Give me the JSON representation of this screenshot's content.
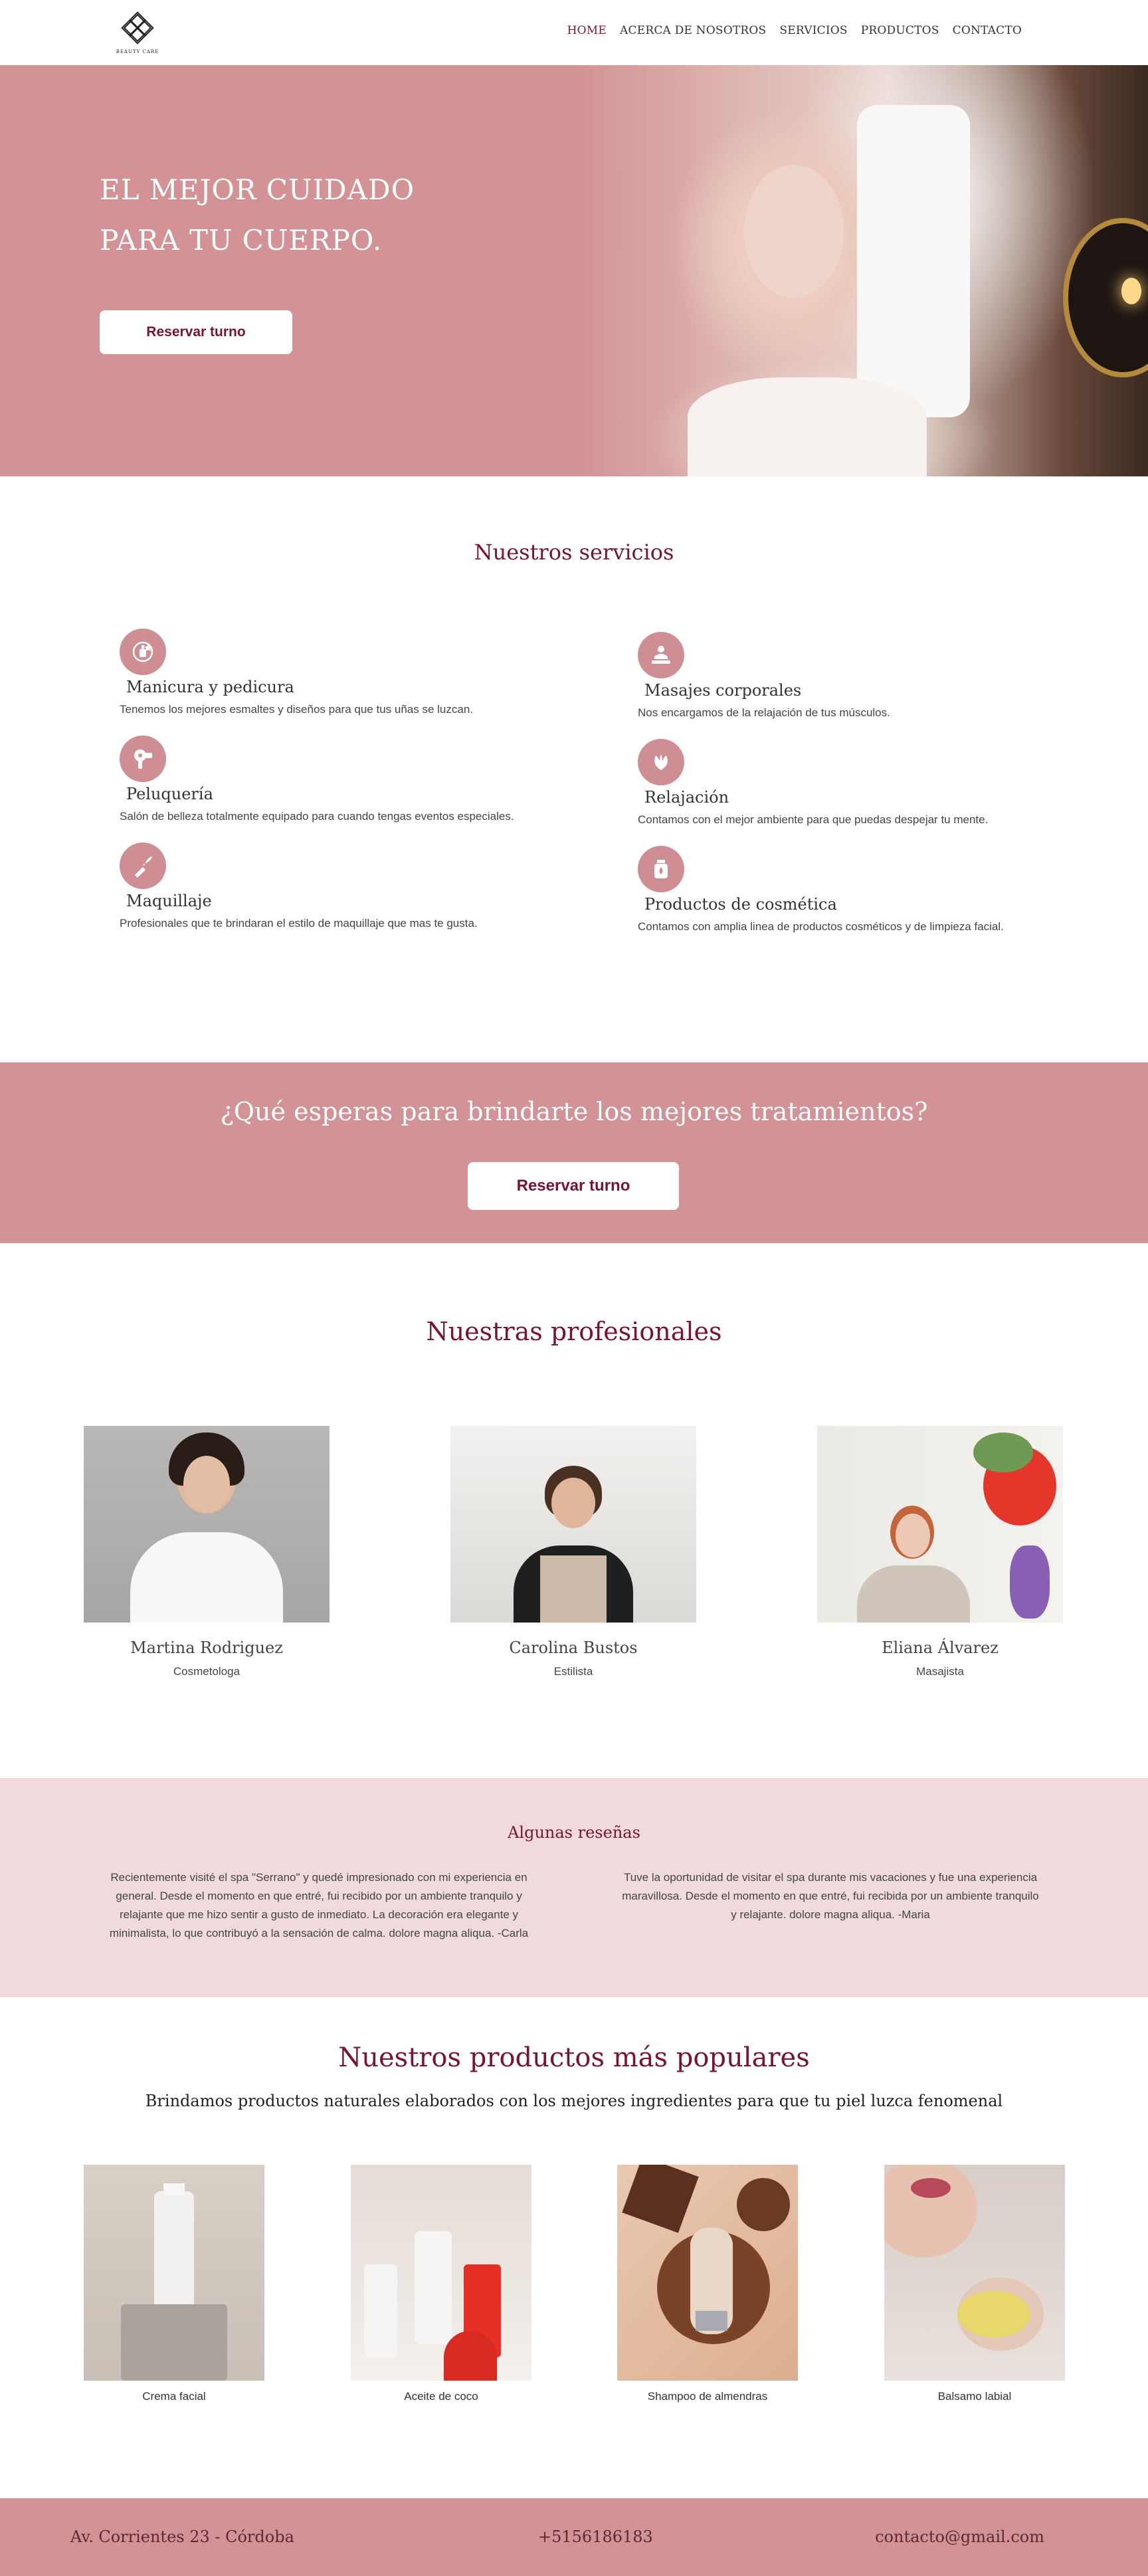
{
  "nav": {
    "logo_text": "BEAUTY CARE",
    "links": [
      {
        "label": "HOME",
        "active": true
      },
      {
        "label": "ACERCA DE NOSOTROS",
        "active": false
      },
      {
        "label": "SERVICIOS",
        "active": false
      },
      {
        "label": "PRODUCTOS",
        "active": false
      },
      {
        "label": "CONTACTO",
        "active": false
      }
    ]
  },
  "hero": {
    "title_line1": "EL MEJOR CUIDADO",
    "title_line2": "PARA TU CUERPO.",
    "button_label": "Reservar turno"
  },
  "services": {
    "title": "Nuestros servicios",
    "items": [
      {
        "name": "Manicura y pedicura",
        "desc": "Tenemos los mejores esmaltes y diseños para que tus uñas se luzcan.",
        "icon": "nail-polish-icon"
      },
      {
        "name": "Masajes corporales",
        "desc": "Nos encargamos de la relajación de tus músculos.",
        "icon": "massage-icon"
      },
      {
        "name": "Peluquería",
        "desc": "Salón de belleza totalmente equipado para cuando tengas eventos especiales.",
        "icon": "hair-dryer-icon"
      },
      {
        "name": "Relajación",
        "desc": "Contamos con el mejor ambiente para que puedas despejar tu mente.",
        "icon": "leaf-icon"
      },
      {
        "name": "Maquillaje",
        "desc": "Profesionales que te brindaran el estilo de maquillaje que mas te gusta.",
        "icon": "makeup-brush-icon"
      },
      {
        "name": "Productos de cosmética",
        "desc": "Contamos con amplia linea de productos cosméticos y de limpieza facial.",
        "icon": "cosmetic-bottle-icon"
      }
    ]
  },
  "cta": {
    "title": "¿Qué esperas para brindarte los mejores tratamientos?",
    "button_label": "Reservar turno"
  },
  "team": {
    "title": "Nuestras profesionales",
    "members": [
      {
        "name": "Martina Rodriguez",
        "role": "Cosmetologa"
      },
      {
        "name": "Carolina Bustos",
        "role": "Estilista"
      },
      {
        "name": "Eliana Álvarez",
        "role": "Masajista"
      }
    ]
  },
  "reviews": {
    "title": "Algunas reseñas",
    "items": [
      "Recientemente visité el spa \"Serrano\" y quedé impresionado con mi experiencia en general. Desde el momento en que entré, fui recibido por un ambiente tranquilo y relajante que me hizo sentir a gusto de inmediato. La decoración era elegante y minimalista, lo que contribuyó a la sensación de calma. dolore magna aliqua. -Carla",
      "Tuve la oportunidad de visitar el spa durante mis vacaciones y fue una experiencia maravillosa. Desde el momento en que entré, fui recibida por un ambiente tranquilo y relajante. dolore magna aliqua. -Maria"
    ]
  },
  "products": {
    "title": "Nuestros productos más populares",
    "subtitle": "Brindamos productos naturales elaborados con los mejores ingredientes para que tu piel luzca fenomenal",
    "items": [
      {
        "name": "Crema facial"
      },
      {
        "name": "Aceite de coco"
      },
      {
        "name": "Shampoo de almendras"
      },
      {
        "name": "Balsamo labial"
      }
    ]
  },
  "footer": {
    "address": "Av. Corrientes 23 - Córdoba",
    "phone": "+5156186183",
    "email": "contacto@gmail.com"
  },
  "colors": {
    "brand_pink": "#d29296",
    "accent_wine": "#7a1230",
    "reviews_bg": "#f0dadd"
  }
}
